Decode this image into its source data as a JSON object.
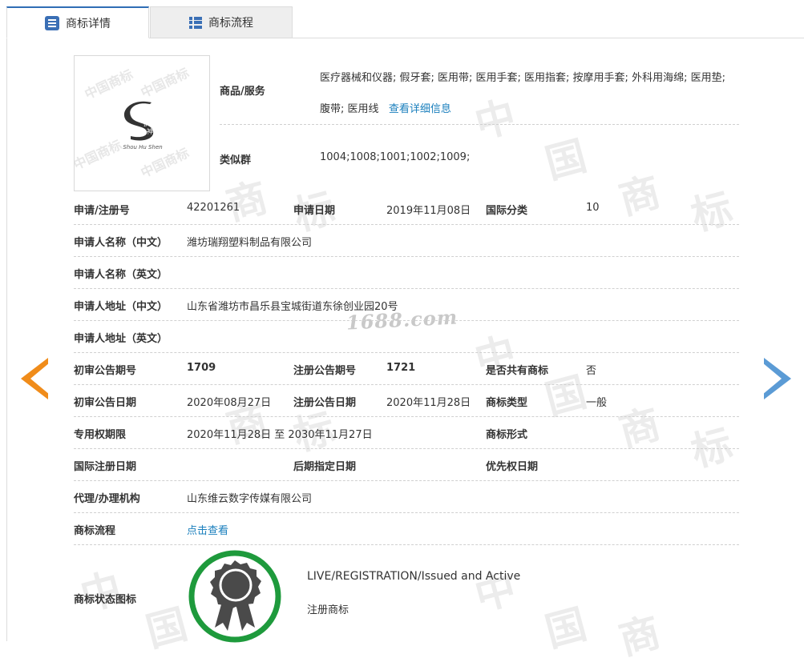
{
  "tabs": [
    {
      "label": "商标详情",
      "active": true
    },
    {
      "label": "商标流程",
      "active": false
    }
  ],
  "watermark": {
    "site": "1688.com"
  },
  "logo": {
    "caption": "Shou Hu Shen",
    "mark_text": "手护神"
  },
  "goods_services": {
    "label": "商品/服务",
    "text": "医疗器械和仪器; 假牙套; 医用带; 医用手套; 医用指套; 按摩用手套; 外科用海绵; 医用垫; 腹带; 医用线",
    "more_link": "查看详细信息"
  },
  "similar_group": {
    "label": "类似群",
    "value": "1004;1008;1001;1002;1009;"
  },
  "fields": {
    "reg_no": {
      "label": "申请/注册号",
      "value": "42201261"
    },
    "apply_date": {
      "label": "申请日期",
      "value": "2019年11月08日"
    },
    "intl_class": {
      "label": "国际分类",
      "value": "10"
    },
    "applicant_cn": {
      "label": "申请人名称（中文）",
      "value": "潍坊瑞翔塑料制品有限公司"
    },
    "applicant_en": {
      "label": "申请人名称（英文）",
      "value": ""
    },
    "address_cn": {
      "label": "申请人地址（中文）",
      "value": "山东省潍坊市昌乐县宝城街道东徐创业园20号"
    },
    "address_en": {
      "label": "申请人地址（英文）",
      "value": ""
    },
    "prelim_issue": {
      "label": "初审公告期号",
      "value": "1709"
    },
    "reg_issue": {
      "label": "注册公告期号",
      "value": "1721"
    },
    "shared": {
      "label": "是否共有商标",
      "value": "否"
    },
    "prelim_date": {
      "label": "初审公告日期",
      "value": "2020年08月27日"
    },
    "reg_date": {
      "label": "注册公告日期",
      "value": "2020年11月28日"
    },
    "tm_type": {
      "label": "商标类型",
      "value": "一般"
    },
    "exclusive": {
      "label": "专用权期限",
      "value": "2020年11月28日 至 2030年11月27日"
    },
    "tm_form": {
      "label": "商标形式",
      "value": ""
    },
    "intl_reg_date": {
      "label": "国际注册日期",
      "value": ""
    },
    "later_date": {
      "label": "后期指定日期",
      "value": ""
    },
    "priority_date": {
      "label": "优先权日期",
      "value": ""
    },
    "agent": {
      "label": "代理/办理机构",
      "value": "山东维云数字传媒有限公司"
    },
    "process": {
      "label": "商标流程",
      "value": "点击查看"
    }
  },
  "status": {
    "label": "商标状态图标",
    "line1": "LIVE/REGISTRATION/Issued and Active",
    "line2": "注册商标"
  },
  "colors": {
    "accent": "#2f6db5",
    "link": "#1a7fbd",
    "badge_ring": "#1e9a3c",
    "arrow_left": "#f08c1a",
    "arrow_right": "#5b9bd5"
  }
}
